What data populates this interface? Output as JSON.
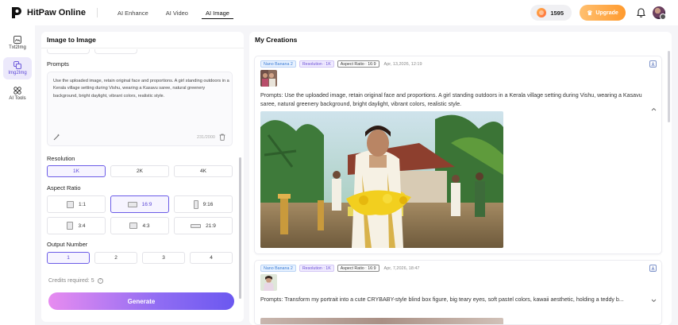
{
  "header": {
    "brand": "HitPaw Online",
    "nav": [
      {
        "label": "AI Enhance",
        "active": false
      },
      {
        "label": "AI Video",
        "active": false
      },
      {
        "label": "AI Image",
        "active": true
      }
    ],
    "credits": "1595",
    "upgrade_label": "Upgrade"
  },
  "sidebar": {
    "items": [
      {
        "label": "Txt2Img",
        "icon": "image-text-icon",
        "active": false
      },
      {
        "label": "Img2Img",
        "icon": "image-swap-icon",
        "active": true
      },
      {
        "label": "AI Tools",
        "icon": "grid-tools-icon",
        "active": false
      }
    ]
  },
  "left_panel": {
    "title": "Image to Image",
    "prompts_label": "Prompts",
    "prompt_text": "Use the uploaded image, retain original face and proportions. A girl standing outdoors in a Kerala village setting during Vishu, wearing a Kasavu saree, natural greenery background, bright daylight, vibrant colors, realistic style.",
    "char_count": "231/2000",
    "resolution_label": "Resolution",
    "resolutions": [
      {
        "label": "1K",
        "selected": true
      },
      {
        "label": "2K",
        "selected": false
      },
      {
        "label": "4K",
        "selected": false
      }
    ],
    "aspect_label": "Aspect Ratio",
    "aspects": [
      {
        "label": "1:1",
        "selected": false
      },
      {
        "label": "16:9",
        "selected": true
      },
      {
        "label": "9:16",
        "selected": false
      },
      {
        "label": "3:4",
        "selected": false
      },
      {
        "label": "4:3",
        "selected": false
      },
      {
        "label": "21:9",
        "selected": false
      }
    ],
    "output_label": "Output Number",
    "outputs": [
      {
        "label": "1",
        "selected": true
      },
      {
        "label": "2",
        "selected": false
      },
      {
        "label": "3",
        "selected": false
      },
      {
        "label": "4",
        "selected": false
      }
    ],
    "credits_required": "Credits required: 5",
    "generate_label": "Generate"
  },
  "creations": {
    "title": "My Creations",
    "items": [
      {
        "model": "Nano Banana 2",
        "resolution": "Resolution : 1K",
        "aspect": "Aspect Ratio : 16:9",
        "date": "Apr, 13,2026, 12:19",
        "prompt": "Prompts: Use the uploaded image, retain original face and proportions. A girl standing outdoors in a Kerala village setting during Vishu, wearing a Kasavu saree, natural greenery background, bright daylight, vibrant colors, realistic style."
      },
      {
        "model": "Nano Banana 2",
        "resolution": "Resolution : 1K",
        "aspect": "Aspect Ratio : 16:9",
        "date": "Apr, 7,2026, 18:47",
        "prompt": "Prompts: Transform my portrait into a cute CRYBABY-style blind box figure, big teary eyes, soft pastel colors, kawaii aesthetic, holding a teddy b..."
      }
    ]
  },
  "colors": {
    "accent": "#6b5ce7",
    "upgrade": "#ff9a2e",
    "generate_start": "#e78cf0",
    "generate_end": "#6b58f0"
  }
}
